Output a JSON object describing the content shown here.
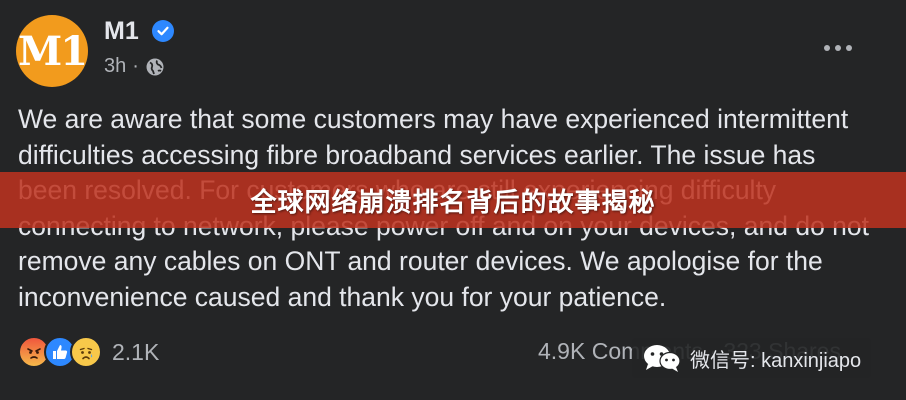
{
  "post": {
    "page_name": "M1",
    "avatar_logo": "M1",
    "time": "3h",
    "separator": "·",
    "message": "We are aware that some customers may have experienced intermittent difficulties accessing fibre broadband services earlier. The issue has been resolved. For customers who are still experiencing difficulty connecting to network, please power off and on your devices, and do not remove any cables on ONT and router devices. We apologise for the inconvenience caused and thank you for your patience.",
    "reaction_count": "2.1K",
    "stats": "4.9K Comments · 323 Shares"
  },
  "overlay": {
    "banner_text": "全球网络崩溃排名背后的故事揭秘",
    "watermark": "微信号: kanxinjiapo"
  },
  "colors": {
    "background": "#242526",
    "avatar": "#f29b1d",
    "verified": "#2d88ff",
    "banner": "#be3220"
  },
  "icons": {
    "verified": "verified-badge-icon",
    "privacy": "globe-icon",
    "more": "more-options-icon",
    "reactions": [
      "angry-reaction-icon",
      "like-reaction-icon",
      "sad-reaction-icon"
    ]
  }
}
